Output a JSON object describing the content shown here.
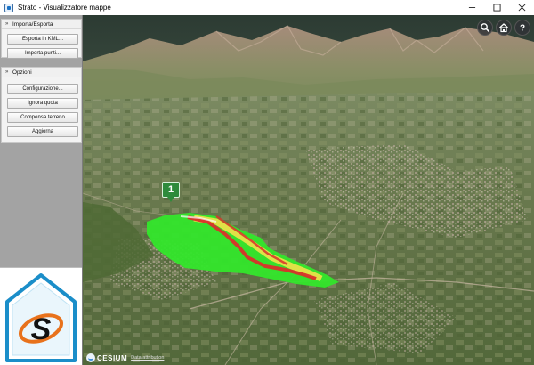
{
  "window": {
    "title": "Strato - Visualizzatore mappe",
    "controls": [
      "minimize",
      "maximize",
      "close"
    ]
  },
  "sidebar": {
    "panels": [
      {
        "header": "Importa/Esporta",
        "buttons": [
          "Esporta in KML...",
          "Importa punti..."
        ]
      },
      {
        "header": "Opzioni",
        "buttons": [
          "Configurazione...",
          "Ignora quota",
          "Compensa terreno",
          "Aggiorna"
        ]
      }
    ],
    "logo_letter": "S"
  },
  "map": {
    "tools": [
      "search-icon",
      "home-icon",
      "help-icon"
    ],
    "marker_label": "1",
    "credits_brand": "CESIUM",
    "credits_data": "Data attribution"
  },
  "colors": {
    "sidebar_bg": "#a3a3a3",
    "marker_green": "#2e8b3c",
    "overlay_green": "#33e62b",
    "overlay_red": "#d9302a",
    "overlay_yellow": "#f2e14a",
    "logo_blue": "#1b8ec9",
    "logo_orange": "#e8721c"
  }
}
